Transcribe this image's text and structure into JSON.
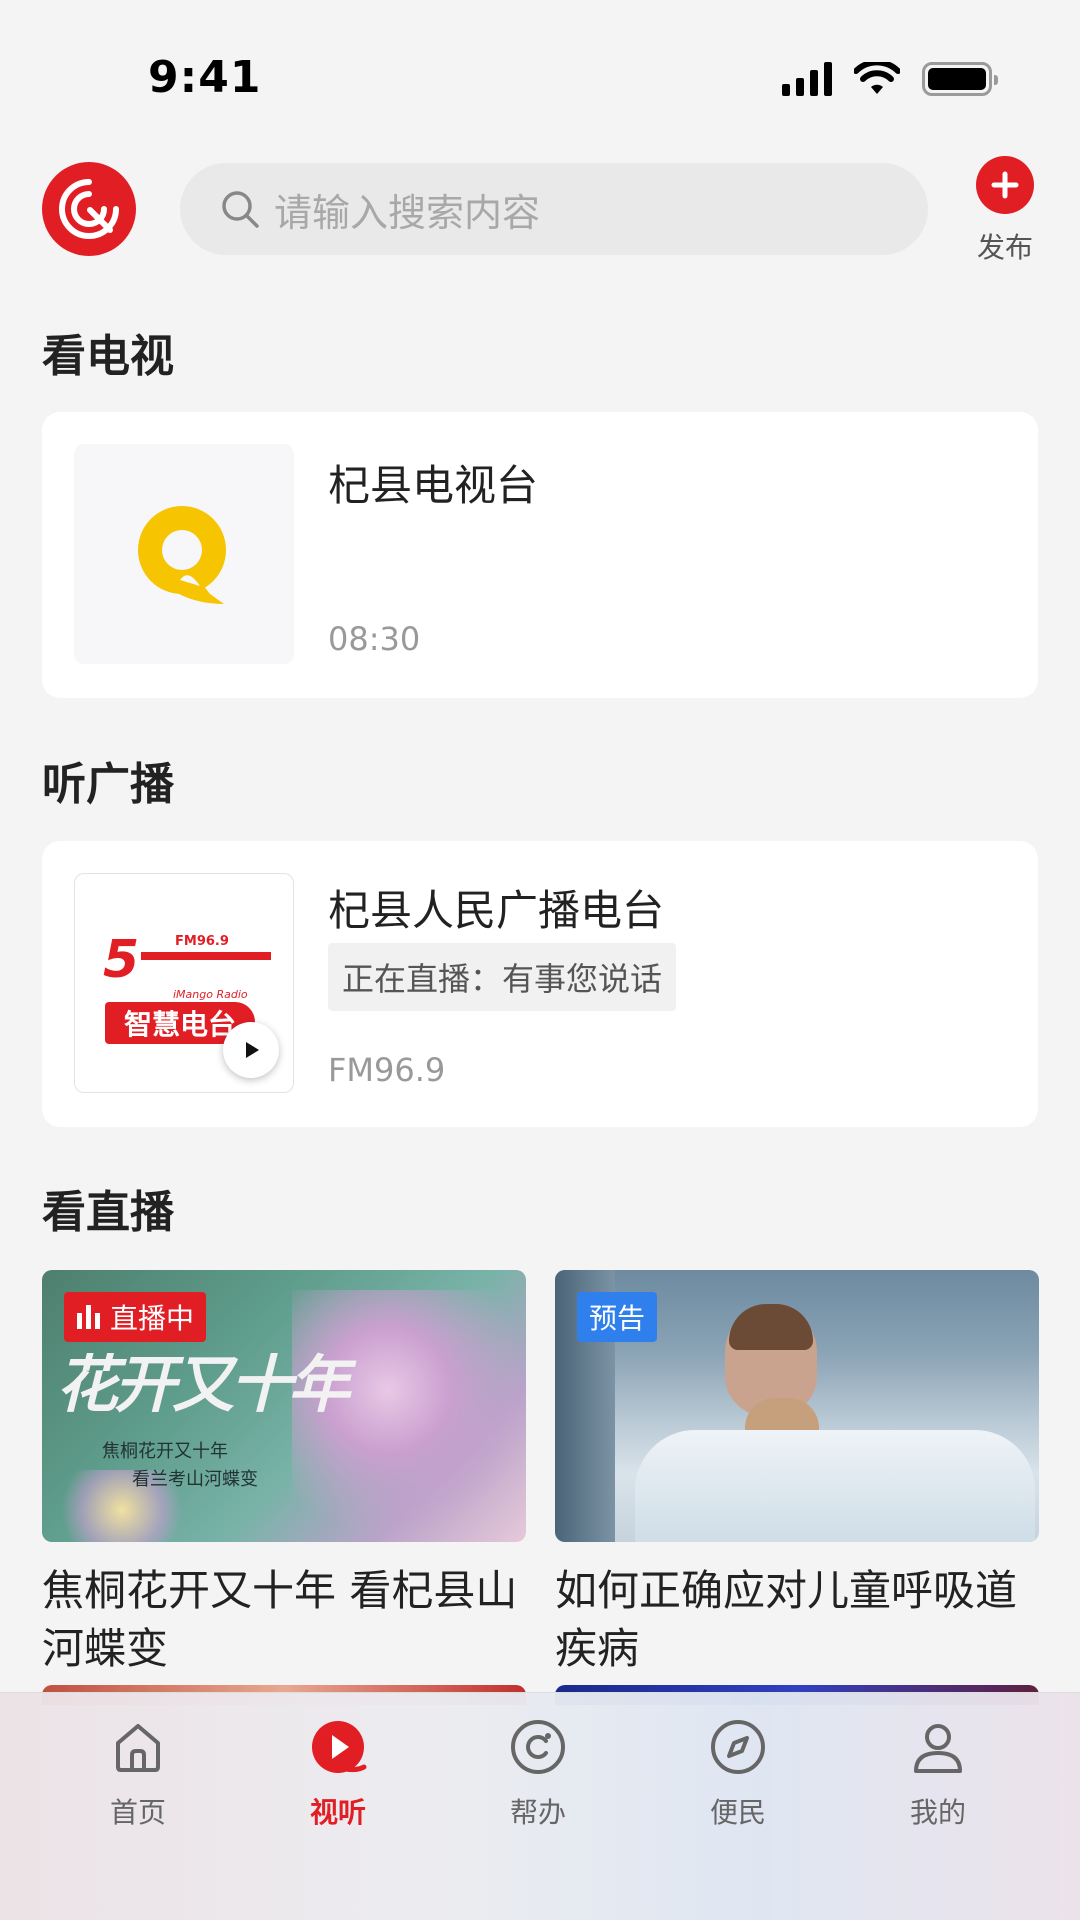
{
  "status_bar": {
    "time": "9:41"
  },
  "header": {
    "search_placeholder": "请输入搜索内容",
    "publish_label": "发布"
  },
  "sections": {
    "tv_title": "看电视",
    "radio_title": "听广播",
    "live_title": "看直播"
  },
  "tv_card": {
    "name": "杞县电视台",
    "time": "08:30"
  },
  "radio_card": {
    "name": "杞县人民广播电台",
    "now_playing": "正在直播：有事您说话",
    "frequency": "FM96.9",
    "logo_text": "智慧电台",
    "logo_sub": "iMango Radio",
    "logo_fm": "FM96.9"
  },
  "live_cards": [
    {
      "badge": "直播中",
      "title": "焦桐花开又十年 看杞县山河蝶变",
      "poster_title": "花开又十年",
      "poster_line1": "焦桐花开又十年",
      "poster_line2": "看兰考山河蝶变"
    },
    {
      "badge": "预告",
      "title": "如何正确应对儿童呼吸道疾病"
    }
  ],
  "tabbar": [
    {
      "label": "首页",
      "icon": "home-icon",
      "active": false
    },
    {
      "label": "视听",
      "icon": "play-icon",
      "active": true
    },
    {
      "label": "帮办",
      "icon": "help-icon",
      "active": false
    },
    {
      "label": "便民",
      "icon": "compass-icon",
      "active": false
    },
    {
      "label": "我的",
      "icon": "user-icon",
      "active": false
    }
  ],
  "colors": {
    "accent": "#e21e25",
    "preview_badge": "#2f80ed"
  }
}
